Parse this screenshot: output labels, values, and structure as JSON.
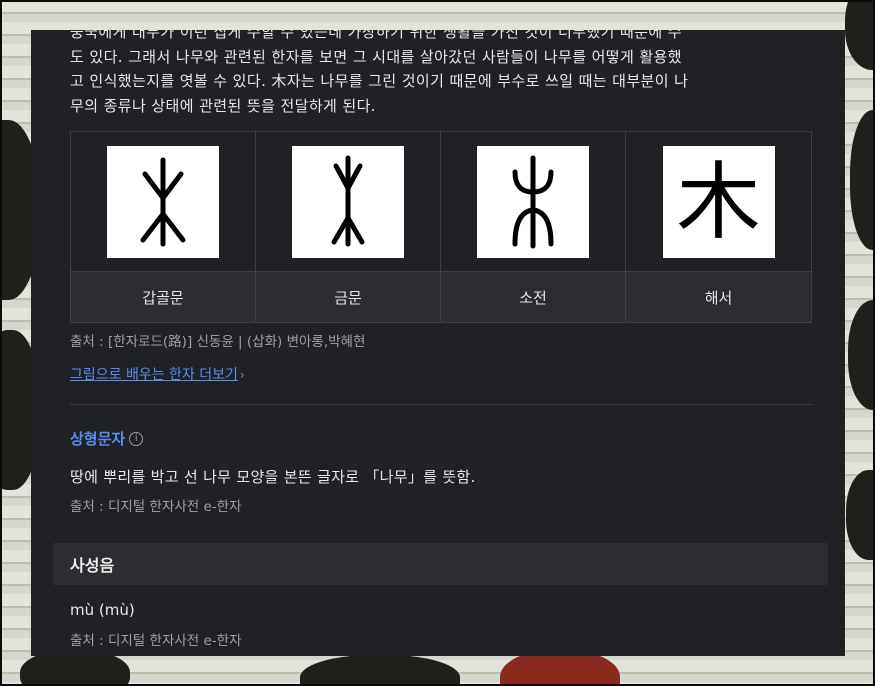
{
  "intro": {
    "line1": "중국에게 대무가 이런 집게 수할 수 있는데 가장하기 위한 생활을 가진 것이 너무했기 때문에 수",
    "line2": "도 있다. 그래서 나무와 관련된 한자를 보면 그 시대를 살아갔던 사람들이 나무를 어떻게 활용했",
    "line3": "고 인식했는지를 엿볼 수 있다. 木자는 나무를 그린 것이기 때문에 부수로 쓰일 때는 대부분이 나",
    "line4": "무의 종류나 상태에 관련된 뜻을 전달하게 된다."
  },
  "glyphs": [
    {
      "label": "갑골문"
    },
    {
      "label": "금문"
    },
    {
      "label": "소전"
    },
    {
      "label": "해서",
      "character": "木"
    }
  ],
  "glyph_source": "출처 : [한자로드(路)] 신동윤 | (삽화) 변아롱,박혜현",
  "more_link": "그림으로 배우는 한자 더보기",
  "more_link_chevron": "›",
  "pictograph": {
    "title": "상형문자",
    "info_icon": "i",
    "meaning": "땅에 뿌리를 박고 선 나무 모양을 본뜬 글자로 「나무」를 뜻함.",
    "source": "출처 : 디지털 한자사전 e-한자"
  },
  "pronunciation": {
    "header": "사성음",
    "reading": "mù (mù)",
    "source": "출처 : 디지털 한자사전 e-한자"
  },
  "colors": {
    "panel": "#202124",
    "link": "#5a8cf2",
    "header_bar": "#2c2d31"
  }
}
